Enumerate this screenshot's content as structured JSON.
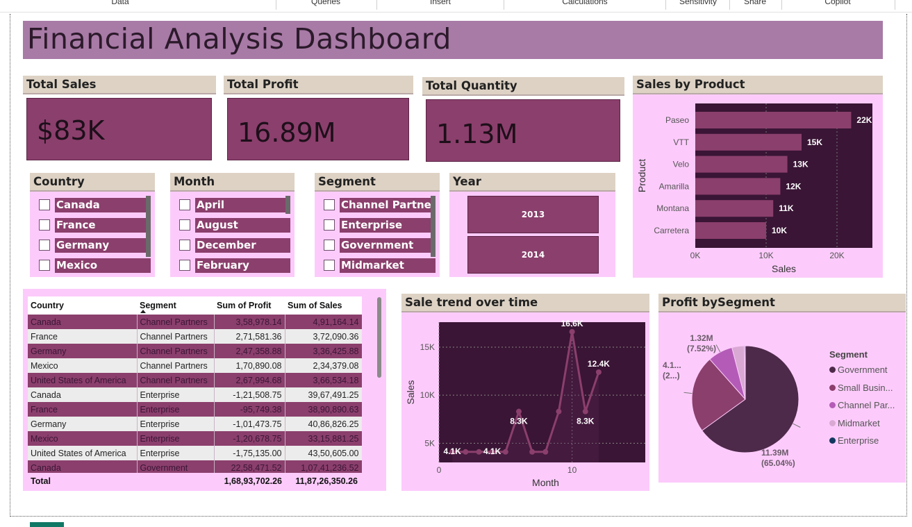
{
  "ribbon": {
    "items": [
      "Data",
      "Queries",
      "Insert",
      "Calculations",
      "Sensitivity",
      "Share",
      "Copilot"
    ]
  },
  "title": "Financial Analysis Dashboard",
  "kpis": {
    "sales": {
      "label": "Total Sales",
      "value": "$83K"
    },
    "profit": {
      "label": "Total Profit",
      "value": "16.89M"
    },
    "quantity": {
      "label": "Total Quantity",
      "value": "1.13M"
    }
  },
  "slicers": {
    "country": {
      "label": "Country",
      "items": [
        "Canada",
        "France",
        "Germany",
        "Mexico"
      ]
    },
    "month": {
      "label": "Month",
      "items": [
        "April",
        "August",
        "December",
        "February"
      ]
    },
    "segment": {
      "label": "Segment",
      "items": [
        "Channel Partners",
        "Enterprise",
        "Government",
        "Midmarket"
      ]
    },
    "year": {
      "label": "Year",
      "items": [
        "2013",
        "2014"
      ]
    }
  },
  "table": {
    "columns": [
      "Country",
      "Segment",
      "Sum of Profit",
      "Sum of Sales"
    ],
    "rows": [
      [
        "Canada",
        "Channel Partners",
        "3,58,978.14",
        "4,91,164.14"
      ],
      [
        "France",
        "Channel Partners",
        "2,71,581.36",
        "3,72,090.36"
      ],
      [
        "Germany",
        "Channel Partners",
        "2,47,358.88",
        "3,36,425.88"
      ],
      [
        "Mexico",
        "Channel Partners",
        "1,70,890.08",
        "2,34,379.08"
      ],
      [
        "United States of America",
        "Channel Partners",
        "2,67,994.68",
        "3,66,534.18"
      ],
      [
        "Canada",
        "Enterprise",
        "-1,21,508.75",
        "39,67,491.25"
      ],
      [
        "France",
        "Enterprise",
        "-95,749.38",
        "38,90,890.63"
      ],
      [
        "Germany",
        "Enterprise",
        "-1,01,473.75",
        "40,86,826.25"
      ],
      [
        "Mexico",
        "Enterprise",
        "-1,20,678.75",
        "33,15,881.25"
      ],
      [
        "United States of America",
        "Enterprise",
        "-1,75,135.00",
        "43,50,605.00"
      ],
      [
        "Canada",
        "Government",
        "22,58,471.52",
        "1,07,41,236.52"
      ]
    ],
    "total": {
      "label": "Total",
      "profit": "1,68,93,702.26",
      "sales": "11,87,26,350.26"
    }
  },
  "chart_data": [
    {
      "type": "bar",
      "title": "Sales by Product",
      "orientation": "horizontal",
      "categories": [
        "Paseo",
        "VTT",
        "Velo",
        "Amarilla",
        "Montana",
        "Carretera"
      ],
      "values": [
        22,
        15,
        13,
        12,
        11,
        10
      ],
      "data_labels": [
        "22K",
        "15K",
        "13K",
        "12K",
        "11K",
        "10K"
      ],
      "xlabel": "Sales",
      "ylabel": "Product",
      "x_ticks": [
        "0K",
        "10K",
        "20K"
      ],
      "xlim": [
        0,
        25
      ],
      "bar_color": "#8b3f6c",
      "plot_background": "#3a1535",
      "panel_background": "#fccbfb"
    },
    {
      "type": "line",
      "title": "Sale trend over time",
      "x": [
        1,
        2,
        3,
        4,
        5,
        6,
        7,
        8,
        9,
        10,
        11,
        12
      ],
      "y": [
        4.1,
        4.1,
        4.1,
        4.1,
        4.1,
        8.3,
        4.1,
        4.1,
        8.3,
        16.6,
        8.3,
        12.4
      ],
      "data_labels": [
        {
          "x": 1,
          "text": "4.1K"
        },
        {
          "x": 4,
          "text": "4.1K"
        },
        {
          "x": 6,
          "text": "8.3K"
        },
        {
          "x": 10,
          "text": "16.6K"
        },
        {
          "x": 11,
          "text": "8.3K"
        },
        {
          "x": 12,
          "text": "12.4K"
        }
      ],
      "xlabel": "Month",
      "ylabel": "Sales",
      "x_ticks": [
        "0",
        "10"
      ],
      "y_ticks": [
        "5K",
        "10K",
        "15K"
      ],
      "xlim": [
        0,
        15.5
      ],
      "ylim": [
        3,
        17.6
      ],
      "line_color": "#8b3f6c",
      "plot_background": "#3a1535",
      "panel_background": "#fccbfb"
    },
    {
      "type": "pie",
      "title": "Profit bySegment",
      "legend_title": "Segment",
      "legend_position": "right",
      "categories": [
        "Government",
        "Small Busin...",
        "Channel Par...",
        "Midmarket",
        "Enterprise"
      ],
      "values": [
        11.39,
        4.1,
        1.32,
        0.66,
        -0.61
      ],
      "percent": [
        65.04,
        23.4,
        7.52,
        3.77,
        0.27
      ],
      "colors": [
        "#4e2a4a",
        "#8b3f6c",
        "#b45bb7",
        "#d9a9d3",
        "#12385f"
      ],
      "data_labels": [
        {
          "value": "11.39M",
          "percent": "(65.04%)"
        },
        {
          "value": "4.1...",
          "percent": "(2...)"
        },
        {
          "value": "1.32M",
          "percent": "(7.52%)"
        }
      ],
      "panel_background": "#fccbfb"
    }
  ]
}
